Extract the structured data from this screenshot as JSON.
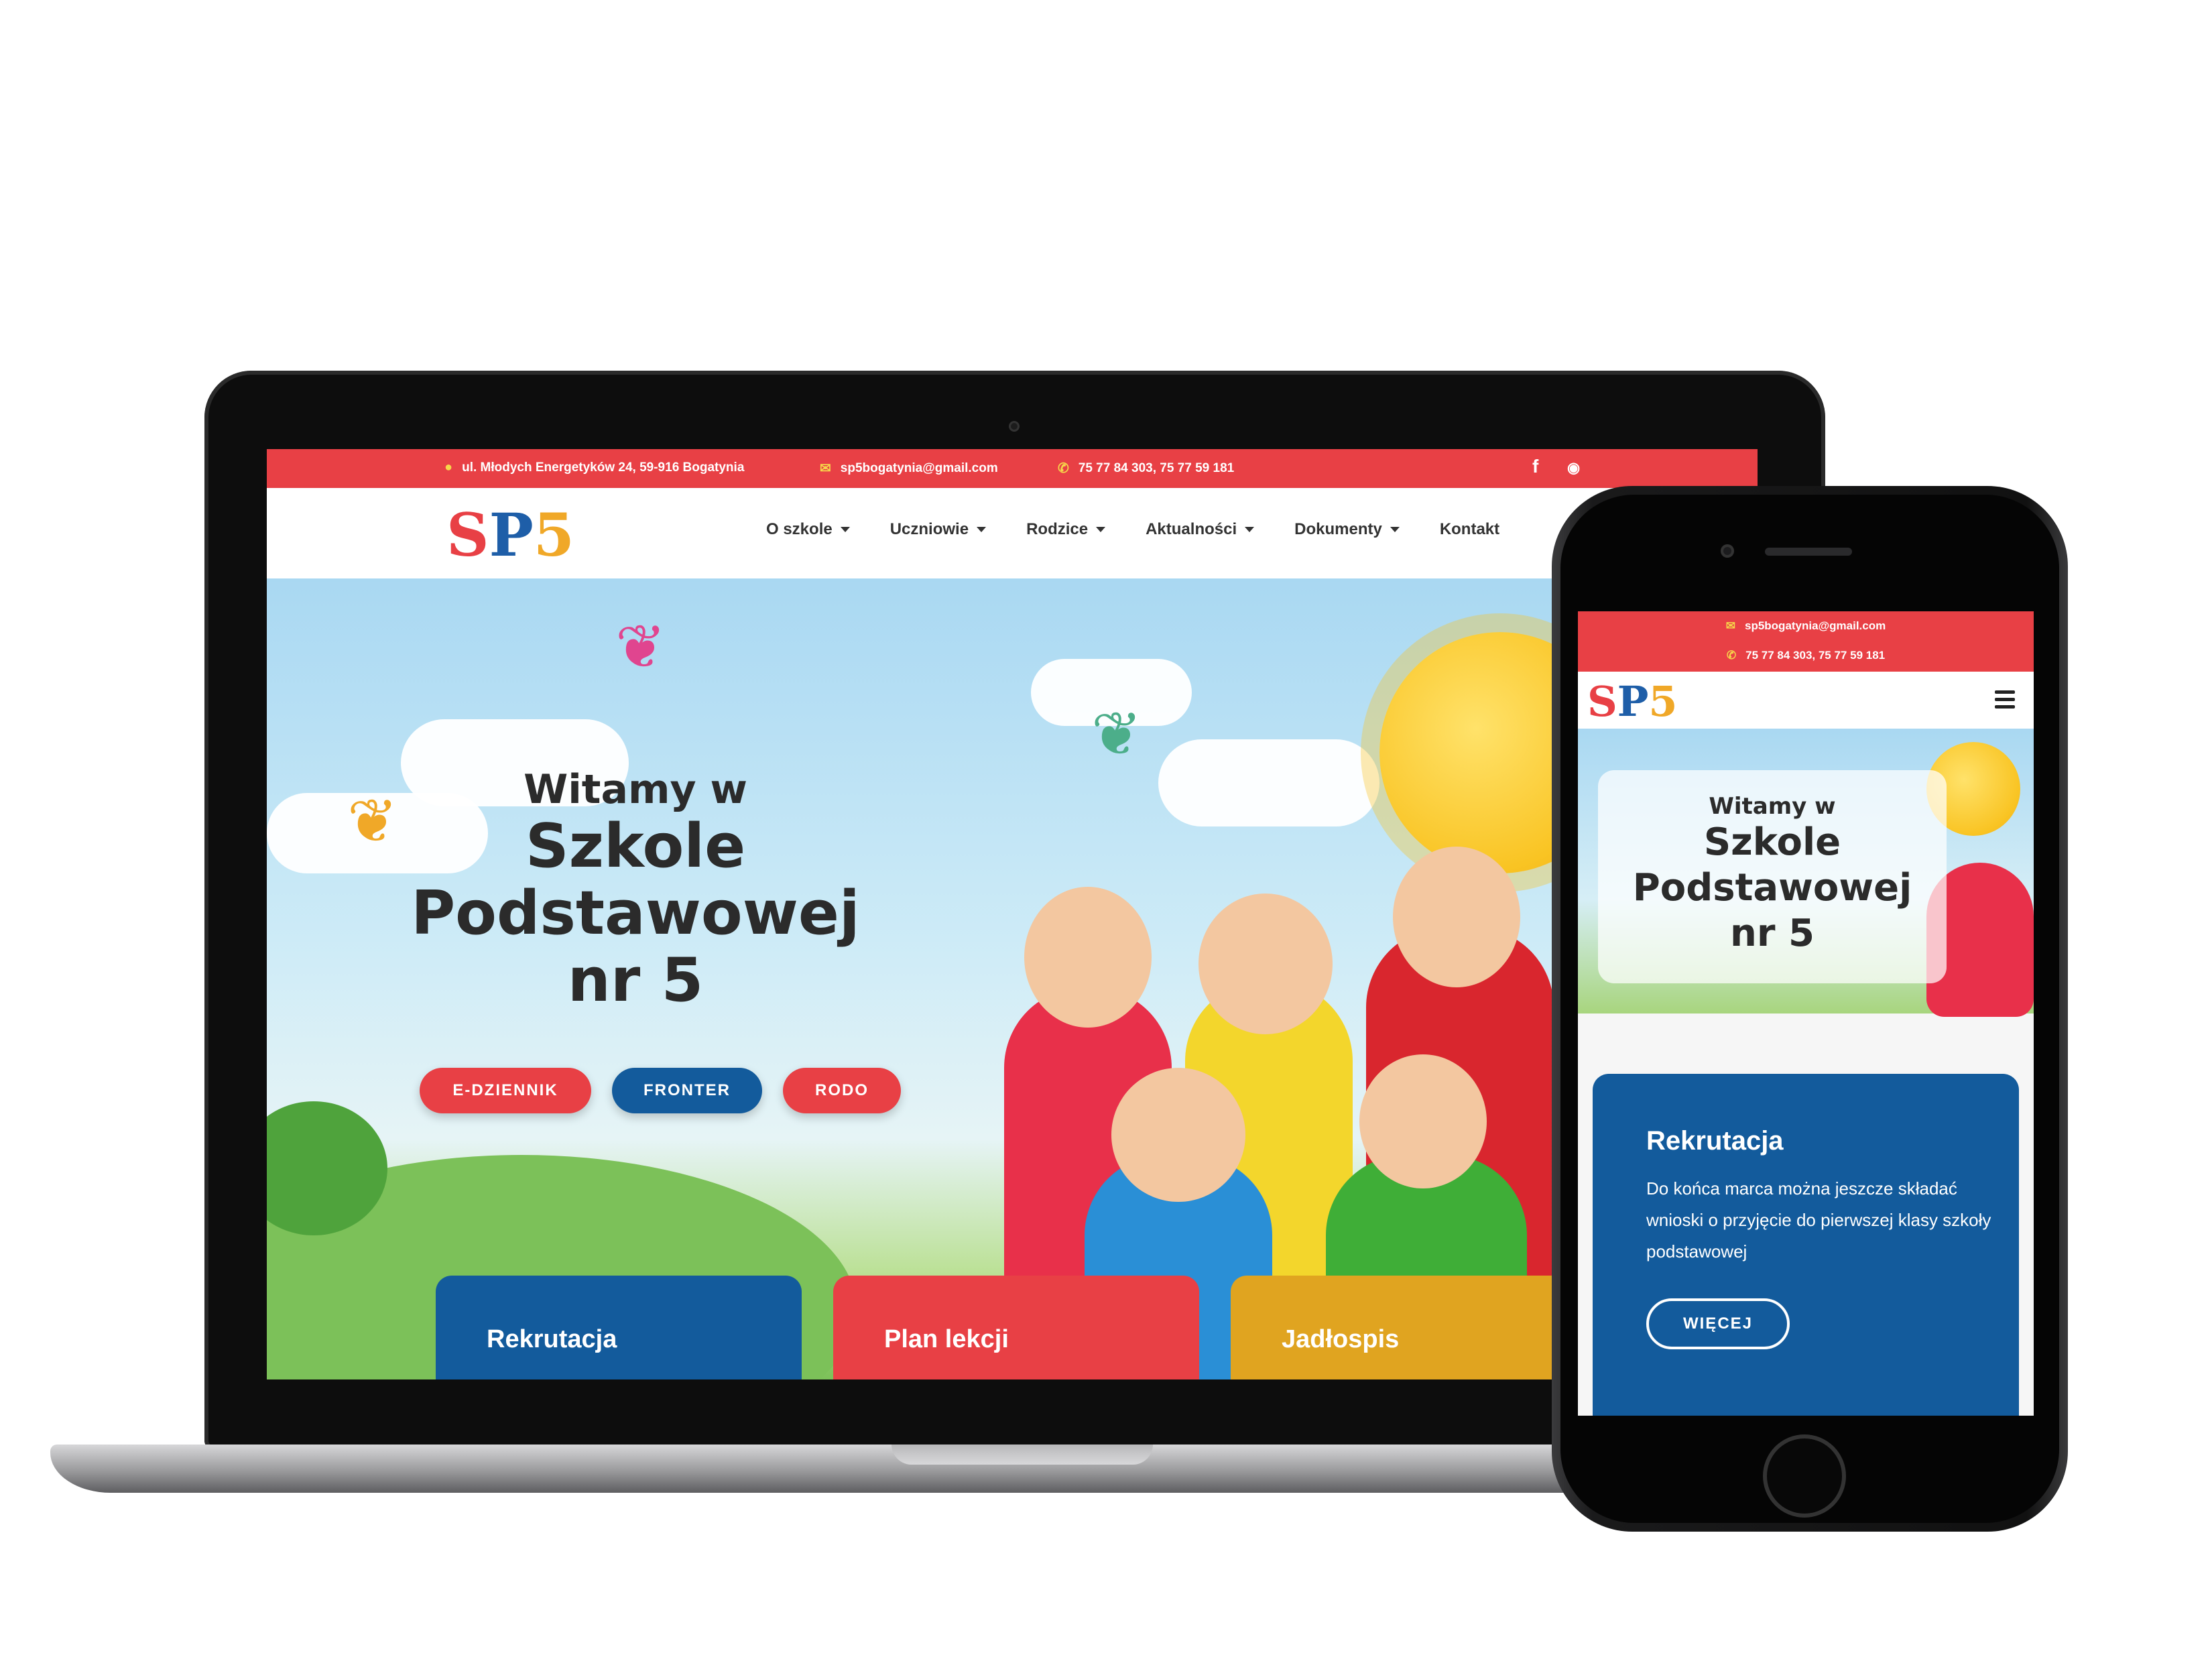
{
  "site": {
    "logo": {
      "s": "S",
      "p": "P",
      "n": "5"
    },
    "contact": {
      "address": "ul. Młodych Energetyków 24, 59-916 Bogatynia",
      "email": "sp5bogatynia@gmail.com",
      "phone": "75 77 84 303, 75 77 59 181"
    },
    "social": [
      {
        "icon": "facebook-icon",
        "glyph": "f"
      },
      {
        "icon": "rss-icon",
        "glyph": "◉"
      }
    ],
    "nav": [
      "O szkole",
      "Uczniowie",
      "Rodzice",
      "Aktualności",
      "Dokumenty",
      "Kontakt"
    ],
    "hero": {
      "line1": "Witamy w",
      "line2": "Szkole",
      "line3": "Podstawowej",
      "line4": "nr 5"
    },
    "buttons": [
      "E-DZIENNIK",
      "FRONTER",
      "RODO"
    ],
    "cards": [
      "Rekrutacja",
      "Plan lekcji",
      "Jadłospis"
    ]
  },
  "mobile": {
    "card": {
      "title": "Rekrutacja",
      "desc": "Do końca marca można jeszcze składać wnioski o przyjęcie do pierwszej klasy szkoły podstawowej",
      "button": "WIĘCEJ"
    }
  },
  "colors": {
    "red": "#e84045",
    "blue": "#135b9c",
    "yellow": "#e0a420"
  }
}
